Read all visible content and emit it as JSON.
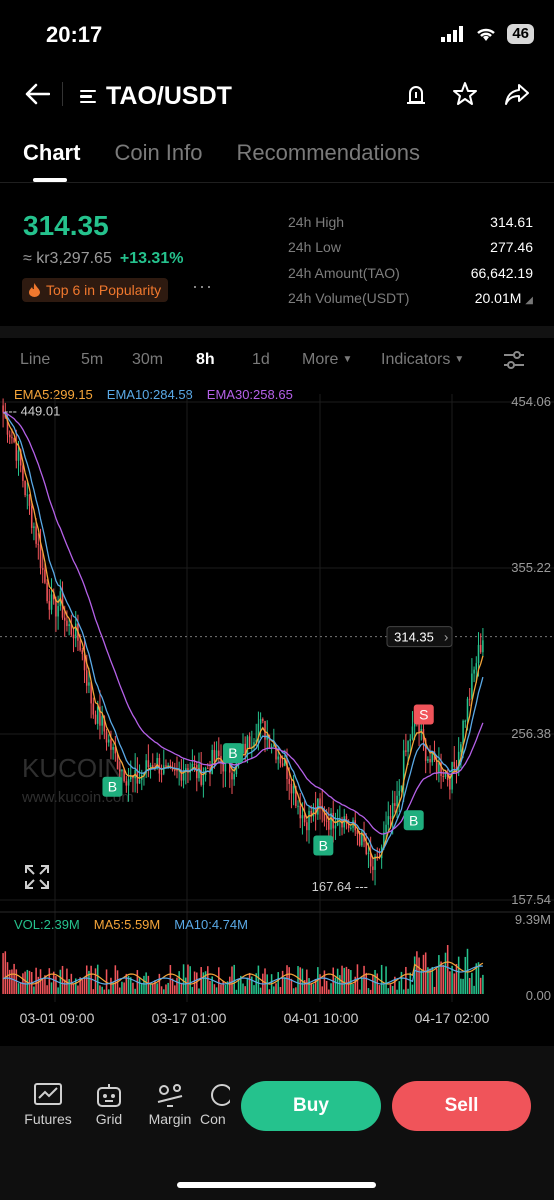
{
  "status": {
    "time": "20:17",
    "battery": "46"
  },
  "header": {
    "pair": "TAO/USDT"
  },
  "tabs": [
    {
      "label": "Chart",
      "active": true
    },
    {
      "label": "Coin Info",
      "active": false
    },
    {
      "label": "Recommendations",
      "active": false
    }
  ],
  "price": {
    "last": "314.35",
    "fiat": "≈ kr3,297.65",
    "change": "+13.31%",
    "popularity": "Top 6 in Popularity",
    "more": "···"
  },
  "stats": [
    {
      "label": "24h High",
      "value": "314.61"
    },
    {
      "label": "24h Low",
      "value": "277.46"
    },
    {
      "label": "24h Amount(TAO)",
      "value": "66,642.19"
    },
    {
      "label": "24h Volume(USDT)",
      "value": "20.01M"
    }
  ],
  "toolbar": {
    "intervals": [
      "Line",
      "5m",
      "30m",
      "8h",
      "1d"
    ],
    "active": "8h",
    "more": "More",
    "indicators": "Indicators"
  },
  "ema": {
    "ema5": "EMA5:299.15",
    "ema10": "EMA10:284.58",
    "ema30": "EMA30:258.65",
    "colors": {
      "ema5": "#f5a53a",
      "ema10": "#5aa9e6",
      "ema30": "#b561e8"
    }
  },
  "volume": {
    "vol": "VOL:2.39M",
    "ma5": "MA5:5.59M",
    "ma10": "MA10:4.74M",
    "colors": {
      "vol": "#25c28d",
      "ma5": "#f5a53a",
      "ma10": "#5aa9e6"
    }
  },
  "chart_data": {
    "type": "candlestick",
    "y_axis_ticks": [
      "454.06",
      "355.22",
      "256.38",
      "157.54"
    ],
    "last_price_tag": "314.35",
    "max_marker": "449.01",
    "min_marker": "167.64",
    "volume_axis": [
      "9.39M",
      "0.00"
    ],
    "x_labels": [
      "03-01 09:00",
      "03-17 01:00",
      "04-01 10:00",
      "04-17 02:00"
    ],
    "watermark": {
      "logo": "KUCOIN",
      "url": "www.kucoin.com"
    },
    "signals": [
      {
        "label": "B",
        "x_date": "03-12",
        "price": 225
      },
      {
        "label": "B",
        "x_date": "03-24",
        "price": 245
      },
      {
        "label": "B",
        "x_date": "04-02",
        "price": 190
      },
      {
        "label": "S",
        "x_date": "04-12",
        "price": 268
      },
      {
        "label": "B",
        "x_date": "04-11",
        "price": 205
      }
    ],
    "close_series": [
      440,
      430,
      415,
      395,
      380,
      360,
      340,
      330,
      335,
      320,
      318,
      310,
      290,
      270,
      265,
      255,
      245,
      238,
      232,
      228,
      230,
      236,
      240,
      238,
      232,
      230,
      234,
      238,
      236,
      232,
      235,
      240,
      242,
      238,
      236,
      240,
      248,
      255,
      262,
      258,
      252,
      245,
      238,
      228,
      215,
      205,
      208,
      212,
      208,
      204,
      210,
      206,
      200,
      198,
      190,
      175,
      178,
      195,
      205,
      215,
      240,
      255,
      262,
      250,
      240,
      238,
      235,
      230,
      240,
      262,
      280,
      300,
      314.35
    ]
  },
  "bottom": {
    "items": [
      "Futures",
      "Grid",
      "Margin",
      "Con"
    ],
    "buy": "Buy",
    "sell": "Sell"
  }
}
